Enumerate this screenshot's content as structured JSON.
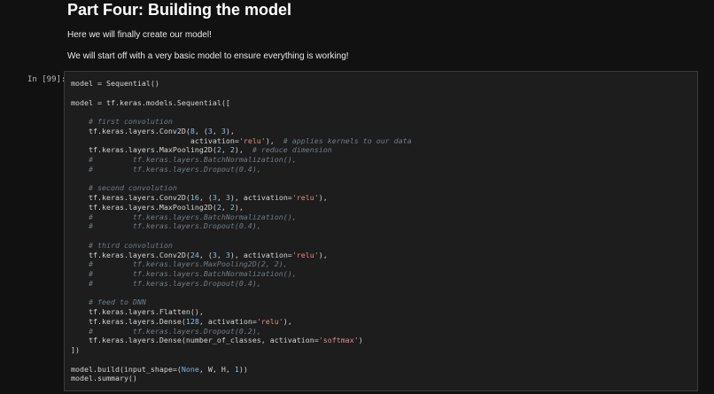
{
  "markdown": {
    "heading": "Part Four: Building the model",
    "paragraphs": [
      "Here we will finally create our model!",
      "We will start off with a very basic model to ensure everything is working!"
    ]
  },
  "cell": {
    "prompt": "In [99]:",
    "lines": [
      [
        {
          "t": "model = Sequential()",
          "c": "t"
        }
      ],
      [],
      [
        {
          "t": "model = tf.keras.models.Sequential([",
          "c": "t"
        }
      ],
      [],
      [
        {
          "t": "    # first convolution",
          "c": "c"
        }
      ],
      [
        {
          "t": "    tf.keras.layers.Conv2D(",
          "c": "t"
        },
        {
          "t": "8",
          "c": "n"
        },
        {
          "t": ", (",
          "c": "t"
        },
        {
          "t": "3",
          "c": "n"
        },
        {
          "t": ", ",
          "c": "t"
        },
        {
          "t": "3",
          "c": "n"
        },
        {
          "t": "),",
          "c": "t"
        }
      ],
      [
        {
          "t": "                           activation=",
          "c": "t"
        },
        {
          "t": "'relu'",
          "c": "s"
        },
        {
          "t": "),  ",
          "c": "t"
        },
        {
          "t": "# applies kernels to our data",
          "c": "c"
        }
      ],
      [
        {
          "t": "    tf.keras.layers.MaxPooling2D(",
          "c": "t"
        },
        {
          "t": "2",
          "c": "n"
        },
        {
          "t": ", ",
          "c": "t"
        },
        {
          "t": "2",
          "c": "n"
        },
        {
          "t": "),  ",
          "c": "t"
        },
        {
          "t": "# reduce dimension",
          "c": "c"
        }
      ],
      [
        {
          "t": "    #         tf.keras.layers.BatchNormalization(),",
          "c": "c"
        }
      ],
      [
        {
          "t": "    #         tf.keras.layers.Dropout(0.4),",
          "c": "c"
        }
      ],
      [],
      [
        {
          "t": "    # second convolution",
          "c": "c"
        }
      ],
      [
        {
          "t": "    tf.keras.layers.Conv2D(",
          "c": "t"
        },
        {
          "t": "16",
          "c": "n"
        },
        {
          "t": ", (",
          "c": "t"
        },
        {
          "t": "3",
          "c": "n"
        },
        {
          "t": ", ",
          "c": "t"
        },
        {
          "t": "3",
          "c": "n"
        },
        {
          "t": "), activation=",
          "c": "t"
        },
        {
          "t": "'relu'",
          "c": "s"
        },
        {
          "t": "),",
          "c": "t"
        }
      ],
      [
        {
          "t": "    tf.keras.layers.MaxPooling2D(",
          "c": "t"
        },
        {
          "t": "2",
          "c": "n"
        },
        {
          "t": ", ",
          "c": "t"
        },
        {
          "t": "2",
          "c": "n"
        },
        {
          "t": "),",
          "c": "t"
        }
      ],
      [
        {
          "t": "    #         tf.keras.layers.BatchNormalization(),",
          "c": "c"
        }
      ],
      [
        {
          "t": "    #         tf.keras.layers.Dropout(0.4),",
          "c": "c"
        }
      ],
      [],
      [
        {
          "t": "    # third convolution",
          "c": "c"
        }
      ],
      [
        {
          "t": "    tf.keras.layers.Conv2D(",
          "c": "t"
        },
        {
          "t": "24",
          "c": "n"
        },
        {
          "t": ", (",
          "c": "t"
        },
        {
          "t": "3",
          "c": "n"
        },
        {
          "t": ", ",
          "c": "t"
        },
        {
          "t": "3",
          "c": "n"
        },
        {
          "t": "), activation=",
          "c": "t"
        },
        {
          "t": "'relu'",
          "c": "s"
        },
        {
          "t": "),",
          "c": "t"
        }
      ],
      [
        {
          "t": "    #         tf.keras.layers.MaxPooling2D(2, 2),",
          "c": "c"
        }
      ],
      [
        {
          "t": "    #         tf.keras.layers.BatchNormalization(),",
          "c": "c"
        }
      ],
      [
        {
          "t": "    #         tf.keras.layers.Dropout(0.4),",
          "c": "c"
        }
      ],
      [],
      [
        {
          "t": "    # feed to DNN",
          "c": "c"
        }
      ],
      [
        {
          "t": "    tf.keras.layers.Flatten(),",
          "c": "t"
        }
      ],
      [
        {
          "t": "    tf.keras.layers.Dense(",
          "c": "t"
        },
        {
          "t": "128",
          "c": "n"
        },
        {
          "t": ", activation=",
          "c": "t"
        },
        {
          "t": "'relu'",
          "c": "s"
        },
        {
          "t": "),",
          "c": "t"
        }
      ],
      [
        {
          "t": "    #         tf.keras.layers.Dropout(0.2),",
          "c": "c"
        }
      ],
      [
        {
          "t": "    tf.keras.layers.Dense(number_of_classes, activation=",
          "c": "t"
        },
        {
          "t": "'softmax'",
          "c": "s"
        },
        {
          "t": ")",
          "c": "t"
        }
      ],
      [
        {
          "t": "])",
          "c": "t"
        }
      ],
      [],
      [
        {
          "t": "model.build(input_shape=(",
          "c": "t"
        },
        {
          "t": "None",
          "c": "k"
        },
        {
          "t": ", W, H, ",
          "c": "t"
        },
        {
          "t": "1",
          "c": "n"
        },
        {
          "t": "))",
          "c": "t"
        }
      ],
      [
        {
          "t": "model.summary()",
          "c": "t"
        }
      ]
    ]
  }
}
